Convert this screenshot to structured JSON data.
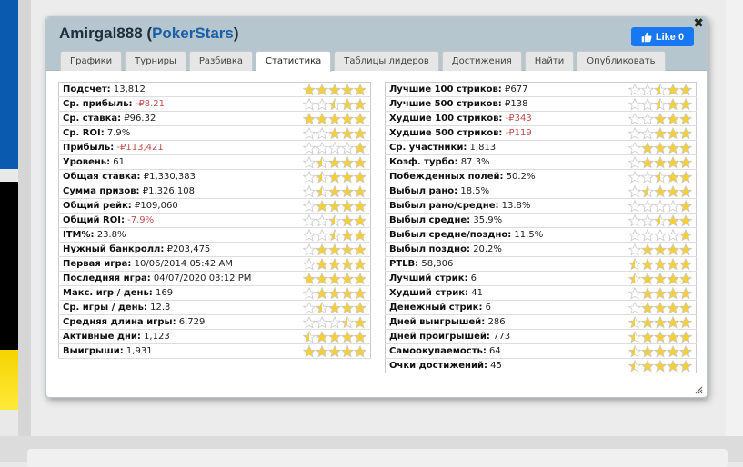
{
  "dialog": {
    "player": "Amirgal888",
    "paren_open": "(",
    "site": "PokerStars",
    "paren_close": ")",
    "close_label": "✖",
    "like_label": "Like 0"
  },
  "tabs": [
    "Графики",
    "Турниры",
    "Разбивка",
    "Статистика",
    "Таблицы лидеров",
    "Достижения",
    "Найти",
    "Опубликовать"
  ],
  "active_tab": "Статистика",
  "colors": {
    "star_full": "#f4cf3a",
    "star_empty": "#ffffff",
    "negative": "#c0504d",
    "header_bg": "#b5c6ce",
    "like_bg": "#1877f2"
  },
  "left_stats": [
    {
      "label": "Подсчет:",
      "value": "13,812",
      "stars": 5,
      "negative": false
    },
    {
      "label": "Ср. прибыль:",
      "value": "-₽8.21",
      "stars": 2.5,
      "negative": true
    },
    {
      "label": "Ср. ставка:",
      "value": "₽96.32",
      "stars": 5,
      "negative": false
    },
    {
      "label": "Ср. ROI:",
      "value": "7.9%",
      "stars": 3,
      "negative": false
    },
    {
      "label": "Прибыль:",
      "value": "-₽113,421",
      "stars": 1,
      "negative": true
    },
    {
      "label": "Уровень:",
      "value": "61",
      "stars": 3.5,
      "negative": false
    },
    {
      "label": "Общая ставка:",
      "value": "₽1,330,383",
      "stars": 3.5,
      "negative": false
    },
    {
      "label": "Сумма призов:",
      "value": "₽1,326,108",
      "stars": 3.5,
      "negative": false
    },
    {
      "label": "Общий рейк:",
      "value": "₽109,060",
      "stars": 4,
      "negative": false
    },
    {
      "label": "Общий ROI:",
      "value": "-7.9%",
      "stars": 2.5,
      "negative": true
    },
    {
      "label": "ITM%:",
      "value": "23.8%",
      "stars": 2.5,
      "negative": false
    },
    {
      "label": "Нужный банкролл:",
      "value": "₽203,475",
      "stars": 4,
      "negative": false
    },
    {
      "label": "Первая игра:",
      "value": "10/06/2014 05:42 AM",
      "stars": 4,
      "negative": false
    },
    {
      "label": "Последняя игра:",
      "value": "04/07/2020 03:12 PM",
      "stars": 5,
      "negative": false
    },
    {
      "label": "Макс. игр / день:",
      "value": "169",
      "stars": 4,
      "negative": false
    },
    {
      "label": "Ср. игры / день:",
      "value": "12.3",
      "stars": 3.5,
      "negative": false
    },
    {
      "label": "Средняя длина игры:",
      "value": "6,729",
      "stars": 1.5,
      "negative": false
    },
    {
      "label": "Активные дни:",
      "value": "1,123",
      "stars": 4.5,
      "negative": false
    },
    {
      "label": "Выигрыши:",
      "value": "1,931",
      "stars": 5,
      "negative": false
    }
  ],
  "right_stats": [
    {
      "label": "Лучшие 100 стриков:",
      "value": "₽677",
      "stars": 2.5,
      "negative": false
    },
    {
      "label": "Лучшие 500 стриков:",
      "value": "₽138",
      "stars": 2.5,
      "negative": false
    },
    {
      "label": "Худшие 100 стриков:",
      "value": "-₽343",
      "stars": 3,
      "negative": true
    },
    {
      "label": "Худшие 500 стриков:",
      "value": "-₽119",
      "stars": 3,
      "negative": true
    },
    {
      "label": "Ср. участники:",
      "value": "1,813",
      "stars": 4,
      "negative": false
    },
    {
      "label": "Коэф. турбо:",
      "value": "87.3%",
      "stars": 4,
      "negative": false
    },
    {
      "label": "Побежденных полей:",
      "value": "50.2%",
      "stars": 2.5,
      "negative": false
    },
    {
      "label": "Выбыл рано:",
      "value": "18.5%",
      "stars": 3.5,
      "negative": false
    },
    {
      "label": "Выбыл рано/средне:",
      "value": "13.8%",
      "stars": 1,
      "negative": false
    },
    {
      "label": "Выбыл средне:",
      "value": "35.9%",
      "stars": 2.5,
      "negative": false
    },
    {
      "label": "Выбыл средне/поздно:",
      "value": "11.5%",
      "stars": 1,
      "negative": false
    },
    {
      "label": "Выбыл поздно:",
      "value": "20.2%",
      "stars": 4,
      "negative": false
    },
    {
      "label": "PTLB:",
      "value": "58,806",
      "stars": 4.5,
      "negative": false
    },
    {
      "label": "Лучший стрик:",
      "value": "6",
      "stars": 4.5,
      "negative": false
    },
    {
      "label": "Худший стрик:",
      "value": "41",
      "stars": 4,
      "negative": false
    },
    {
      "label": "Денежный стрик:",
      "value": "6",
      "stars": 4,
      "negative": false
    },
    {
      "label": "Дней выигрышей:",
      "value": "286",
      "stars": 4.5,
      "negative": false
    },
    {
      "label": "Дней проигрышей:",
      "value": "773",
      "stars": 4.5,
      "negative": false
    },
    {
      "label": "Самоокупаемость:",
      "value": "64",
      "stars": 4.5,
      "negative": false
    },
    {
      "label": "Очки достижений:",
      "value": "45",
      "stars": 4.5,
      "negative": false
    }
  ]
}
